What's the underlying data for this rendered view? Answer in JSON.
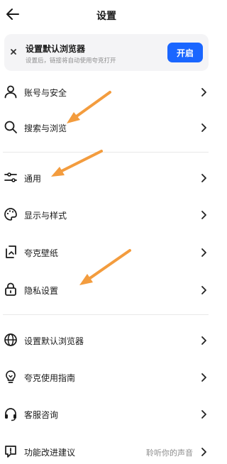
{
  "header": {
    "title": "设置",
    "back_icon": "back-arrow-icon"
  },
  "banner": {
    "title": "设置默认浏览器",
    "subtitle": "设置后，链接将自动使用夸克打开",
    "button_label": "开启",
    "button_color": "#1a66ff",
    "close_icon": "close-icon"
  },
  "items": [
    {
      "label": "账号与安全",
      "icon": "user-icon"
    },
    {
      "label": "搜索与浏览",
      "icon": "search-icon"
    },
    {
      "label": "通用",
      "icon": "sliders-icon"
    },
    {
      "label": "显示与样式",
      "icon": "palette-icon"
    },
    {
      "label": "夸克壁纸",
      "icon": "wallpaper-icon"
    },
    {
      "label": "隐私设置",
      "icon": "lock-icon"
    },
    {
      "label": "设置默认浏览器",
      "icon": "globe-icon"
    },
    {
      "label": "夸克使用指南",
      "icon": "lightbulb-icon"
    },
    {
      "label": "客服咨询",
      "icon": "headset-icon"
    },
    {
      "label": "功能改进建议",
      "icon": "feedback-icon",
      "value": "聆听你的声音"
    }
  ],
  "annotation_color": "#f39c3e"
}
